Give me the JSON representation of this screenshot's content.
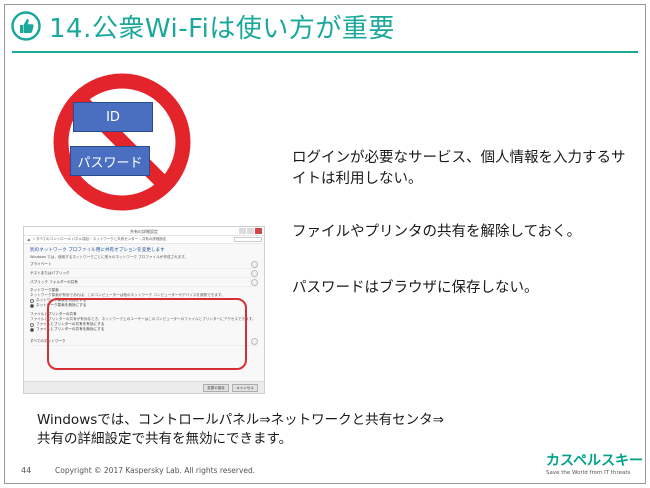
{
  "slide": {
    "title": "14.公衆Wi-Fiは使い方が重要",
    "bullets": [
      "ログインが必要なサービス、個人情報を入力するサイトは利用しない。",
      "ファイルやプリンタの共有を解除しておく。",
      "パスワードはブラウザに保存しない。"
    ],
    "illustration": {
      "id_label": "ID",
      "password_label": "パスワード",
      "icon": "prohibited-icon"
    },
    "footnote_line1": "Windowsでは、コントロールパネル⇒ネットワークと共有センタ⇒",
    "footnote_line2": "共有の詳細設定で共有を無効にできます。",
    "page_number": "44",
    "copyright": "Copyright © 2017 Kaspersky Lab. All rights reserved.",
    "logo_text": "カスペルスキー",
    "logo_tagline": "Save the World from IT threats",
    "accent_color": "#1aa89b",
    "highlight_color": "#d63035"
  },
  "dialog": {
    "title": "共有の詳細設定",
    "breadcrumb": "« すべてのコントロール パネル項目 › ネットワークと共有センター › 共有の詳細設定",
    "heading": "別のネットワーク プロファイル用に共有オプションを変更します",
    "desc": "Windows では、使用するネットワークごとに別々のネットワーク プロファイルが作成されます。",
    "rows": [
      "プライベート",
      "ゲストまたはパブリック",
      "パブリック フォルダーの共有"
    ],
    "section1": "ネットワーク探索",
    "section1_desc": "ネットワーク探索が有効であれば、このコンピューターは他のネットワーク コンピューターやデバイスを参照できます。",
    "radio1_on": "ネットワーク探索を有効にする",
    "radio1_off": "ネットワーク探索を無効にする",
    "section2": "ファイルとプリンターの共有",
    "section2_desc": "ファイルとプリンターの共有が有効なとき、ネットワーク上のユーザーはこのコンピューターのファイルとプリンターにアクセスできます。",
    "radio2_off": "ファイルとプリンターの共有を有効にする",
    "radio2_on": "ファイルとプリンターの共有を無効にする",
    "last_row": "すべてのネットワーク",
    "save_button": "変更の保存",
    "cancel_button": "キャンセル"
  }
}
